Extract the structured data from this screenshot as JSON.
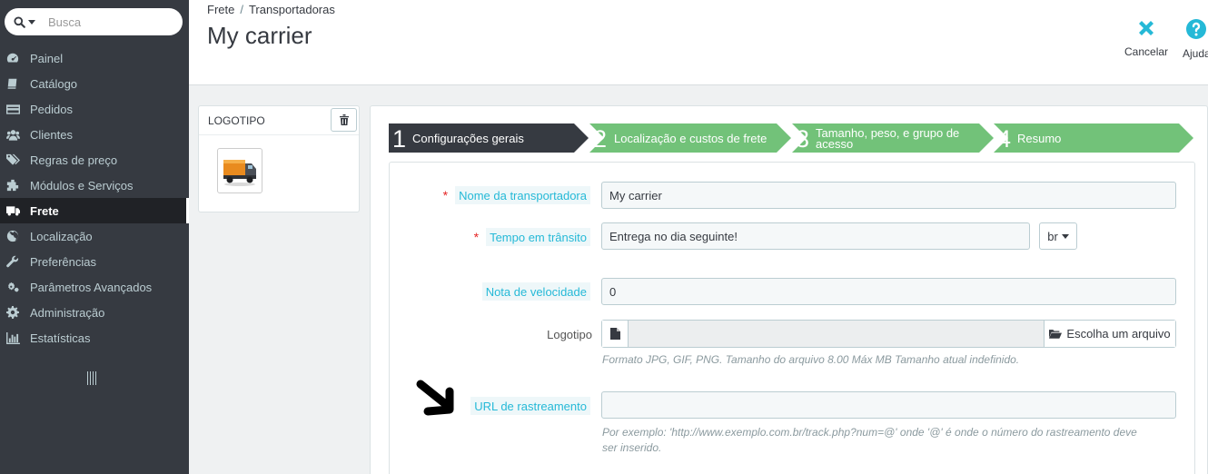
{
  "sidebar": {
    "search_placeholder": "Busca",
    "items": [
      {
        "label": "Painel",
        "icon": "dashboard-icon"
      },
      {
        "label": "Catálogo",
        "icon": "book-icon"
      },
      {
        "label": "Pedidos",
        "icon": "credit-card-icon"
      },
      {
        "label": "Clientes",
        "icon": "users-icon"
      },
      {
        "label": "Regras de preço",
        "icon": "tags-icon"
      },
      {
        "label": "Módulos e Serviços",
        "icon": "puzzle-icon"
      },
      {
        "label": "Frete",
        "icon": "truck-icon",
        "active": true
      },
      {
        "label": "Localização",
        "icon": "globe-icon"
      },
      {
        "label": "Preferências",
        "icon": "wrench-icon"
      },
      {
        "label": "Parâmetros Avançados",
        "icon": "cogs-icon"
      },
      {
        "label": "Administração",
        "icon": "gear-icon"
      },
      {
        "label": "Estatísticas",
        "icon": "bar-chart-icon"
      }
    ]
  },
  "header": {
    "breadcrumb": [
      "Frete",
      "Transportadoras"
    ],
    "breadcrumb_sep": "/",
    "title": "My carrier",
    "toolbar": {
      "cancel_label": "Cancelar",
      "help_label": "Ajuda"
    }
  },
  "logo_panel": {
    "title": "LOGOTIPO"
  },
  "wizard": {
    "steps": [
      {
        "num": "1",
        "label": "Configurações gerais",
        "active": true
      },
      {
        "num": "2",
        "label": "Localização e custos de frete"
      },
      {
        "num": "3",
        "label_line1": "Tamanho, peso, e grupo de",
        "label_line2": "acesso"
      },
      {
        "num": "4",
        "label": "Resumo"
      }
    ]
  },
  "form": {
    "name_label": "Nome da transportadora",
    "name_value": "My carrier",
    "transit_label": "Tempo em trânsito",
    "transit_value": "Entrega no dia seguinte!",
    "lang": "br",
    "speed_label": "Nota de velocidade",
    "speed_value": "0",
    "logo_label": "Logotipo",
    "file_button": "Escolha um arquivo",
    "logo_help": "Formato JPG, GIF, PNG. Tamanho do arquivo 8.00 Máx MB Tamanho atual indefinido.",
    "tracking_label": "URL de rastreamento",
    "tracking_value": "",
    "tracking_help_line1": "Por exemplo: 'http://www.exemplo.com.br/track.php?num=@' onde '@' é onde o número do rastreamento deve",
    "tracking_help_line2": "ser inserido.",
    "required_mark": "*"
  },
  "colors": {
    "sidebar_bg": "#363a41",
    "step_active": "#363a41",
    "step_inactive": "#72c279",
    "accent": "#25b9d7"
  }
}
